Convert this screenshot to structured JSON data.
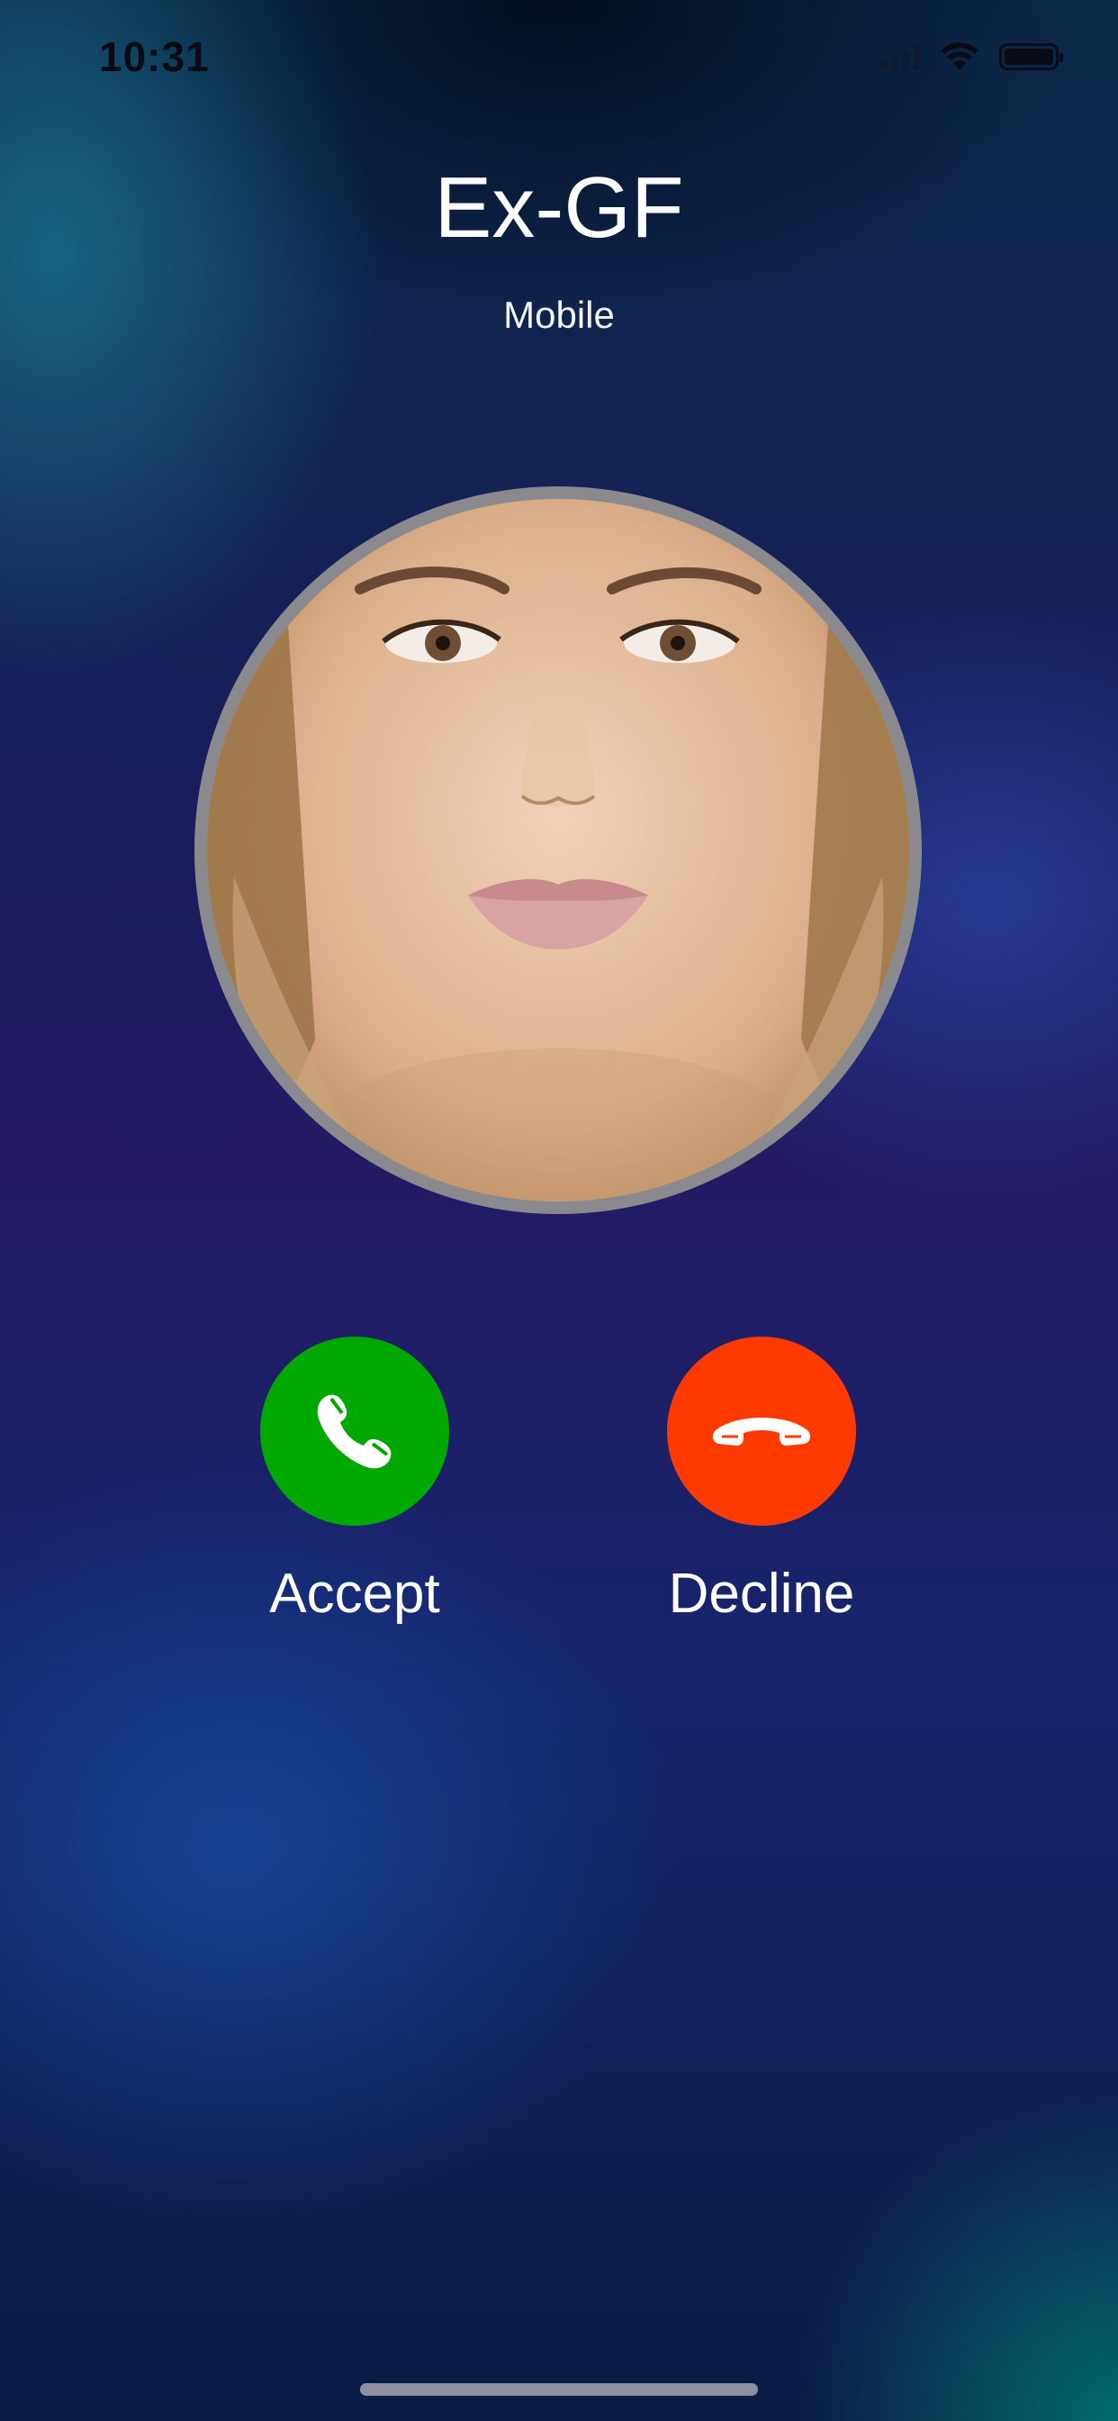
{
  "status_bar": {
    "time": "10:31",
    "icons": [
      "cellular-signal-icon",
      "wifi-icon",
      "battery-icon"
    ]
  },
  "caller": {
    "name": "Ex-GF",
    "type": "Mobile",
    "photo": "contact-photo-woman"
  },
  "actions": {
    "accept": {
      "label": "Accept",
      "icon": "phone-icon",
      "color": "#00a800"
    },
    "decline": {
      "label": "Decline",
      "icon": "hang-up-icon",
      "color": "#ff3a00"
    }
  }
}
